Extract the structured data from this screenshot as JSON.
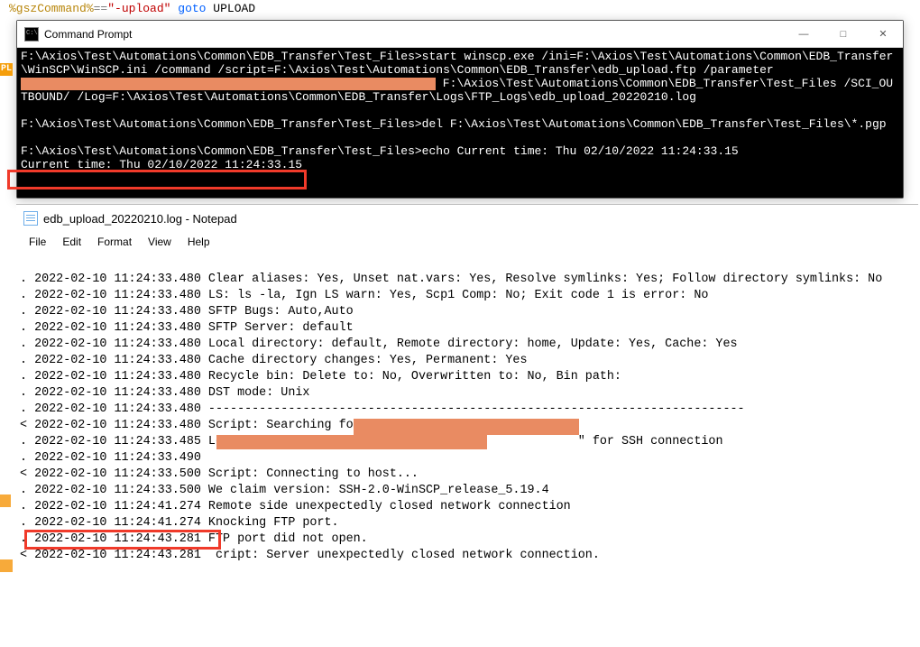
{
  "bg_code": {
    "line": "%gszCommand%==\"-upload\" goto UPLOAD"
  },
  "cmd": {
    "title": "Command Prompt",
    "body_line1": "F:\\Axios\\Test\\Automations\\Common\\EDB_Transfer\\Test_Files>start winscp.exe /ini=F:\\Axios\\Test\\Automations\\Common\\EDB_Transfer\\WinSCP\\WinSCP.ini /command /script=F:\\Axios\\Test\\Automations\\Common\\EDB_Transfer\\edb_upload.ftp /parameter ",
    "body_line1b": " F:\\Axios\\Test\\Automations\\Common\\EDB_Transfer\\Test_Files /SCI_OUTBOUND/ /Log=F:\\Axios\\Test\\Automations\\Common\\EDB_Transfer\\Logs\\FTP_Logs\\edb_upload_20220210.log",
    "blank": "",
    "body_line2": "F:\\Axios\\Test\\Automations\\Common\\EDB_Transfer\\Test_Files>del F:\\Axios\\Test\\Automations\\Common\\EDB_Transfer\\Test_Files\\*.pgp",
    "body_line3": "F:\\Axios\\Test\\Automations\\Common\\EDB_Transfer\\Test_Files>echo Current time: Thu 02/10/2022 11:24:33.15",
    "body_line4": "Current time: Thu 02/10/2022 11:24:33.15"
  },
  "notepad": {
    "title": "edb_upload_20220210.log - Notepad",
    "menu": {
      "file": "File",
      "edit": "Edit",
      "format": "Format",
      "view": "View",
      "help": "Help"
    },
    "lines": {
      "l0": ". 2022-02-10 11:24:33.480 Clear aliases: Yes, Unset nat.vars: Yes, Resolve symlinks: Yes; Follow directory symlinks: No",
      "l1": ". 2022-02-10 11:24:33.480 LS: ls -la, Ign LS warn: Yes, Scp1 Comp: No; Exit code 1 is error: No",
      "l2": ". 2022-02-10 11:24:33.480 SFTP Bugs: Auto,Auto",
      "l3": ". 2022-02-10 11:24:33.480 SFTP Server: default",
      "l4": ". 2022-02-10 11:24:33.480 Local directory: default, Remote directory: home, Update: Yes, Cache: Yes",
      "l5": ". 2022-02-10 11:24:33.480 Cache directory changes: Yes, Permanent: Yes",
      "l6": ". 2022-02-10 11:24:33.480 Recycle bin: Delete to: No, Overwritten to: No, Bin path:",
      "l7": ". 2022-02-10 11:24:33.480 DST mode: Unix",
      "l8": ". 2022-02-10 11:24:33.480 --------------------------------------------------------------------------",
      "l9": "< 2022-02-10 11:24:33.480 Script: Searching for host...",
      "l10a": ". 2022-02-10 11:24:33.485 Looking up host \"",
      "l10b": "\" for SSH connection",
      "l11": ". 2022-02-10 11:24:33.490 ",
      "l12": "< 2022-02-10 11:24:33.500 Script: Connecting to host...",
      "l13": ". 2022-02-10 11:24:33.500 We claim version: SSH-2.0-WinSCP_release_5.19.4",
      "l14": ". 2022-02-10 11:24:41.274 Remote side unexpectedly closed network connection",
      "l15": ". 2022-02-10 11:24:41.274 Knocking FTP port.",
      "l16": ". 2022-02-10 11:24:43.281 FTP port did not open.",
      "l17a": "< 2022-02-10 11:24:43.281 ",
      "l17b": "cript: Server unexpectedly closed network connection."
    }
  },
  "win_controls": {
    "min": "—",
    "max": "□",
    "close": "✕"
  },
  "stubs": {
    "pl": "PL"
  }
}
